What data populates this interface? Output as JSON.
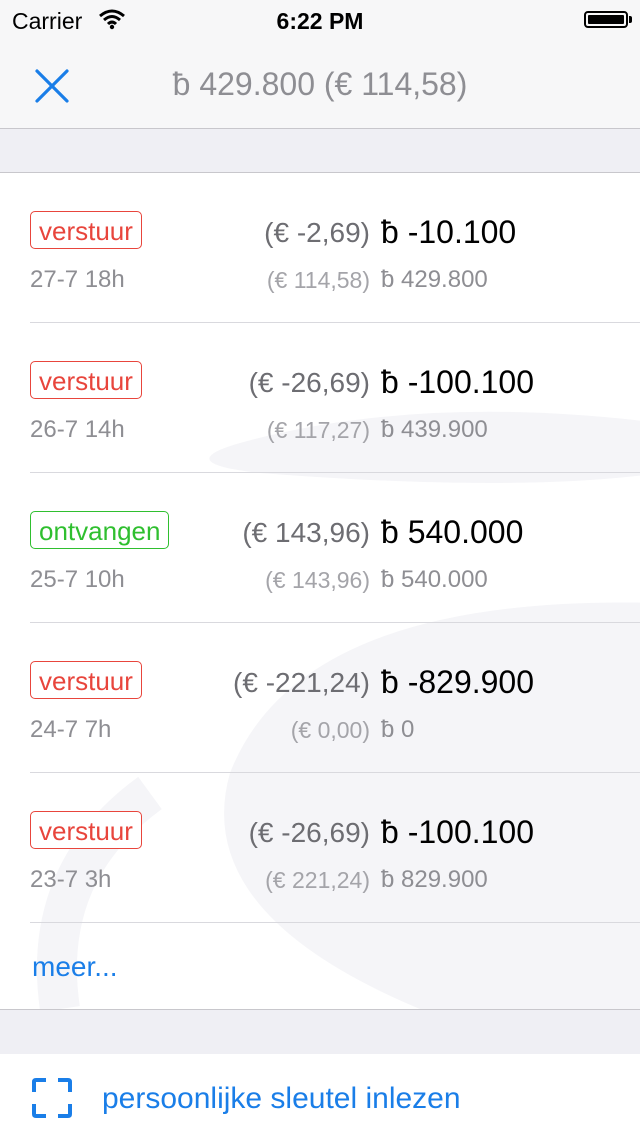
{
  "status_bar": {
    "carrier": "Carrier",
    "time": "6:22 PM"
  },
  "nav": {
    "title": "ƀ 429.800 (€ 114,58)",
    "close_icon": "close-x-icon"
  },
  "colors": {
    "accent": "#1a7ee8",
    "send": "#e8453c",
    "receive": "#2fbf2f"
  },
  "transactions": [
    {
      "type": "verstuur",
      "date": "27-7 18h",
      "eur": "(€ -2,69)",
      "btc": "ƀ -10.100",
      "eur_balance": "(€ 114,58)",
      "btc_balance": "ƀ 429.800"
    },
    {
      "type": "verstuur",
      "date": "26-7 14h",
      "eur": "(€ -26,69)",
      "btc": "ƀ -100.100",
      "eur_balance": "(€ 117,27)",
      "btc_balance": "ƀ 439.900"
    },
    {
      "type": "ontvangen",
      "date": "25-7 10h",
      "eur": "(€ 143,96)",
      "btc": "ƀ 540.000",
      "eur_balance": "(€ 143,96)",
      "btc_balance": "ƀ 540.000"
    },
    {
      "type": "verstuur",
      "date": "24-7 7h",
      "eur": "(€ -221,24)",
      "btc": "ƀ -829.900",
      "eur_balance": "(€ 0,00)",
      "btc_balance": "ƀ 0"
    },
    {
      "type": "verstuur",
      "date": "23-7 3h",
      "eur": "(€ -26,69)",
      "btc": "ƀ -100.100",
      "eur_balance": "(€ 221,24)",
      "btc_balance": "ƀ 829.900"
    }
  ],
  "more_label": "meer...",
  "scan": {
    "label": "persoonlijke sleutel inlezen",
    "icon": "scan-frame-icon"
  }
}
